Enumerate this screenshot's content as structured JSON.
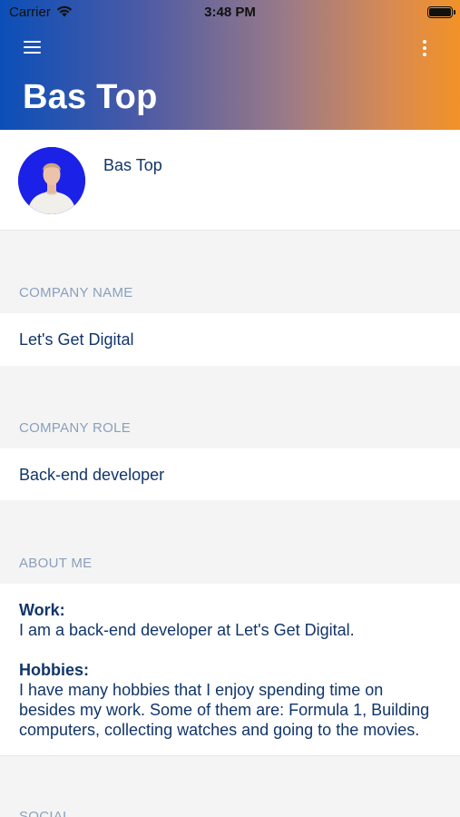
{
  "status_bar": {
    "carrier": "Carrier",
    "time": "3:48 PM"
  },
  "header": {
    "title": "Bas Top",
    "menu_icon": "hamburger-menu-icon",
    "more_icon": "more-vertical-icon"
  },
  "profile": {
    "name": "Bas Top",
    "avatar_bg": "#1c21e8"
  },
  "sections": {
    "company_name": {
      "label": "COMPANY NAME",
      "value": "Let's Get Digital"
    },
    "company_role": {
      "label": "COMPANY ROLE",
      "value": "Back-end developer"
    },
    "about_me": {
      "label": "ABOUT ME",
      "work_heading": "Work:",
      "work_text": "I am a back-end developer at Let's Get Digital.",
      "hobbies_heading": "Hobbies:",
      "hobbies_text": "I have many hobbies that I enjoy spending time on besides my work. Some of them are: Formula 1, Building computers, collecting watches and going to the movies."
    },
    "social": {
      "label": "SOCIAL"
    }
  }
}
